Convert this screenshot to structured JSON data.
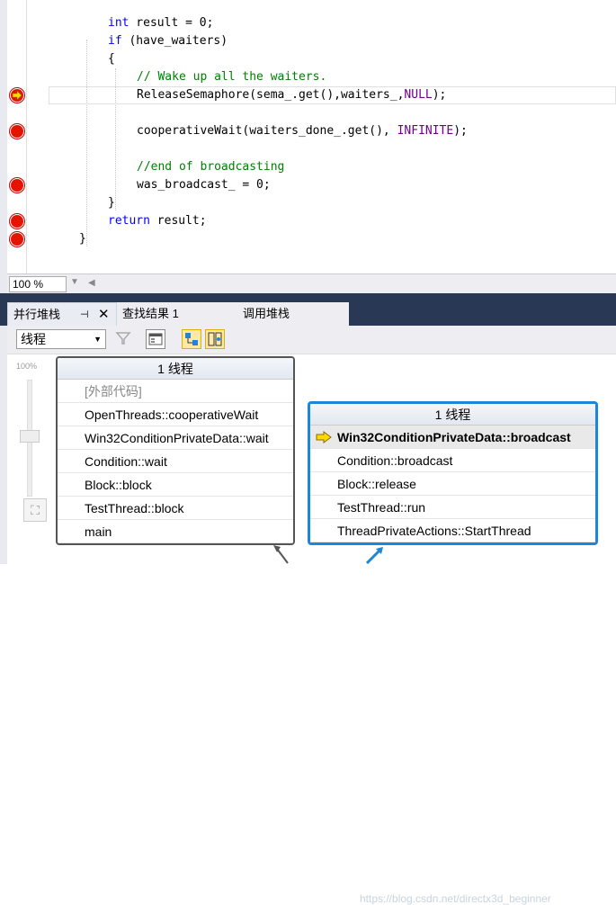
{
  "editor": {
    "lines": [
      {
        "indent": 68,
        "parts": [
          {
            "t": "int",
            "c": "kw"
          },
          {
            "t": " result = 0;"
          }
        ]
      },
      {
        "indent": 68,
        "parts": [
          {
            "t": "if",
            "c": "kw"
          },
          {
            "t": " (have_waiters)"
          }
        ]
      },
      {
        "indent": 68,
        "parts": [
          {
            "t": "{"
          }
        ]
      },
      {
        "indent": 100,
        "parts": [
          {
            "t": "// Wake up all the waiters.",
            "c": "cm"
          }
        ]
      },
      {
        "indent": 100,
        "parts": [
          {
            "t": "ReleaseSemaphore(sema_.get(),waiters_,"
          },
          {
            "t": "NULL",
            "c": "mac"
          },
          {
            "t": ");"
          }
        ]
      },
      {
        "indent": 100,
        "parts": [
          {
            "t": ""
          }
        ]
      },
      {
        "indent": 100,
        "parts": [
          {
            "t": "cooperativeWait(waiters_done_.get(), "
          },
          {
            "t": "INFINITE",
            "c": "mac"
          },
          {
            "t": ");"
          }
        ]
      },
      {
        "indent": 100,
        "parts": [
          {
            "t": ""
          }
        ]
      },
      {
        "indent": 100,
        "parts": [
          {
            "t": "//end of broadcasting",
            "c": "cm"
          }
        ]
      },
      {
        "indent": 100,
        "parts": [
          {
            "t": "was_broadcast_ = 0;"
          }
        ]
      },
      {
        "indent": 68,
        "parts": [
          {
            "t": "}"
          }
        ]
      },
      {
        "indent": 68,
        "parts": [
          {
            "t": "return",
            "c": "kw"
          },
          {
            "t": " result;"
          }
        ]
      },
      {
        "indent": 36,
        "parts": [
          {
            "t": "}"
          }
        ]
      }
    ],
    "breakpoint_lines": [
      4,
      6,
      9,
      11,
      12
    ],
    "current_line": 4
  },
  "status": {
    "zoom": "100 %"
  },
  "tabs": {
    "parallel_stacks": "并行堆栈",
    "pin": "⊣",
    "close": "✕",
    "find_results": "查找结果 1",
    "call_stack": "调用堆栈"
  },
  "toolbar": {
    "thread_select": "线程",
    "dropdown_icon": "▼"
  },
  "canvas": {
    "zoom_pct": "100%",
    "node1": {
      "header": "1 线程",
      "frames": [
        "[外部代码]",
        "OpenThreads::cooperativeWait",
        "Win32ConditionPrivateData::wait",
        "Condition::wait",
        "Block::block",
        "TestThread::block",
        "main"
      ]
    },
    "node2": {
      "header": "1 线程",
      "frames": [
        "Win32ConditionPrivateData::broadcast",
        "Condition::broadcast",
        "Block::release",
        "TestThread::run",
        "ThreadPrivateActions::StartThread"
      ]
    },
    "watermark": "https://blog.csdn.net/directx3d_beginner"
  },
  "colors": {
    "breakpoint": "#e51400",
    "keyword": "#0000ff",
    "comment": "#008000",
    "macro": "#6f008a",
    "active_node_border": "#1c86d8",
    "tab_strip": "#293955"
  }
}
